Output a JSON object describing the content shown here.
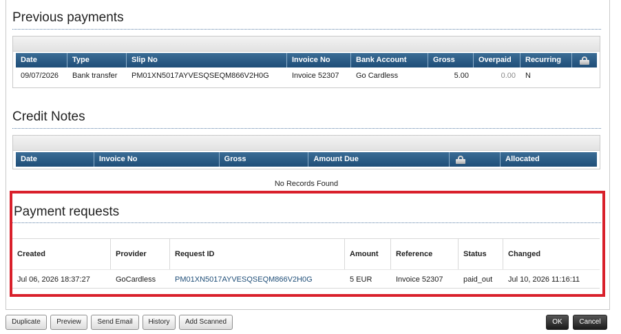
{
  "previous_payments": {
    "title": "Previous payments",
    "columns": [
      "Date",
      "Type",
      "Slip No",
      "Invoice No",
      "Bank Account",
      "Gross",
      "Overpaid",
      "Recurring"
    ],
    "rows": [
      {
        "date": "09/07/2026",
        "type": "Bank transfer",
        "slip_no": "PM01XN5017AYVESQSEQM866V2H0G",
        "invoice_no": "Invoice 52307",
        "bank_account": "Go Cardless",
        "gross": "5.00",
        "overpaid": "0.00",
        "recurring": "N"
      }
    ]
  },
  "credit_notes": {
    "title": "Credit Notes",
    "columns": [
      "Date",
      "Invoice No",
      "Gross",
      "Amount Due",
      "Allocated"
    ],
    "empty_text": "No Records Found"
  },
  "payment_requests": {
    "title": "Payment requests",
    "columns": [
      "Created",
      "Provider",
      "Request ID",
      "Amount",
      "Reference",
      "Status",
      "Changed"
    ],
    "rows": [
      {
        "created": "Jul 06, 2026 18:37:27",
        "provider": "GoCardless",
        "request_id": "PM01XN5017AYVESQSEQM866V2H0G",
        "amount": "5 EUR",
        "reference": "Invoice 52307",
        "status": "paid_out",
        "changed": "Jul 10, 2026 11:16:11"
      }
    ]
  },
  "footer": {
    "buttons": [
      "Duplicate",
      "Preview",
      "Send Email",
      "History",
      "Add Scanned"
    ],
    "ok": "OK",
    "cancel": "Cancel"
  },
  "icons": {
    "lock": "lock-icon"
  },
  "colors": {
    "header_blue": "#1f4e78",
    "highlight_red": "#d9202b",
    "link_blue": "#1f4e78"
  }
}
